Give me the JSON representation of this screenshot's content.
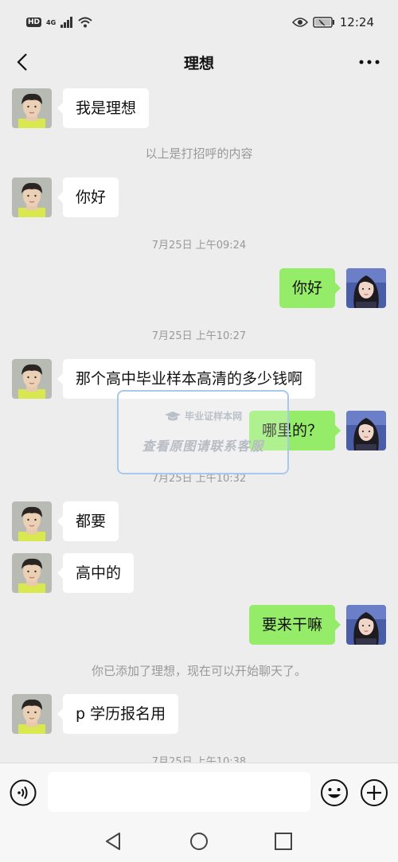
{
  "status_bar": {
    "hd": "HD",
    "network": "4G",
    "time": "12:24"
  },
  "header": {
    "title": "理想",
    "back_icon": "back-arrow-icon",
    "more_icon": "more-dots-icon"
  },
  "messages": [
    {
      "type": "in",
      "text": "我是理想"
    },
    {
      "type": "system",
      "text": "以上是打招呼的内容"
    },
    {
      "type": "in",
      "text": "你好"
    },
    {
      "type": "time",
      "text": "7月25日 上午09:24"
    },
    {
      "type": "out",
      "text": "你好"
    },
    {
      "type": "time",
      "text": "7月25日 上午10:27"
    },
    {
      "type": "in",
      "text": "那个高中毕业样本高清的多少钱啊"
    },
    {
      "type": "out",
      "text": "哪里的？"
    },
    {
      "type": "time",
      "text": "7月25日 上午10:32"
    },
    {
      "type": "in",
      "text": "都要"
    },
    {
      "type": "in",
      "text": "高中的"
    },
    {
      "type": "out",
      "text": "要来干嘛"
    },
    {
      "type": "system",
      "text": "你已添加了理想，现在可以开始聊天了。"
    },
    {
      "type": "in",
      "text": "p 学历报名用"
    },
    {
      "type": "time",
      "text": "7月25日 上午10:38"
    }
  ],
  "watermark": {
    "brand": "毕业证样本网",
    "text": "查看原图请联系客服"
  },
  "input_bar": {
    "placeholder": "",
    "value": ""
  },
  "colors": {
    "background": "#ededed",
    "bubble_out": "#95ec69",
    "bubble_in": "#ffffff",
    "system_text": "#999999"
  }
}
